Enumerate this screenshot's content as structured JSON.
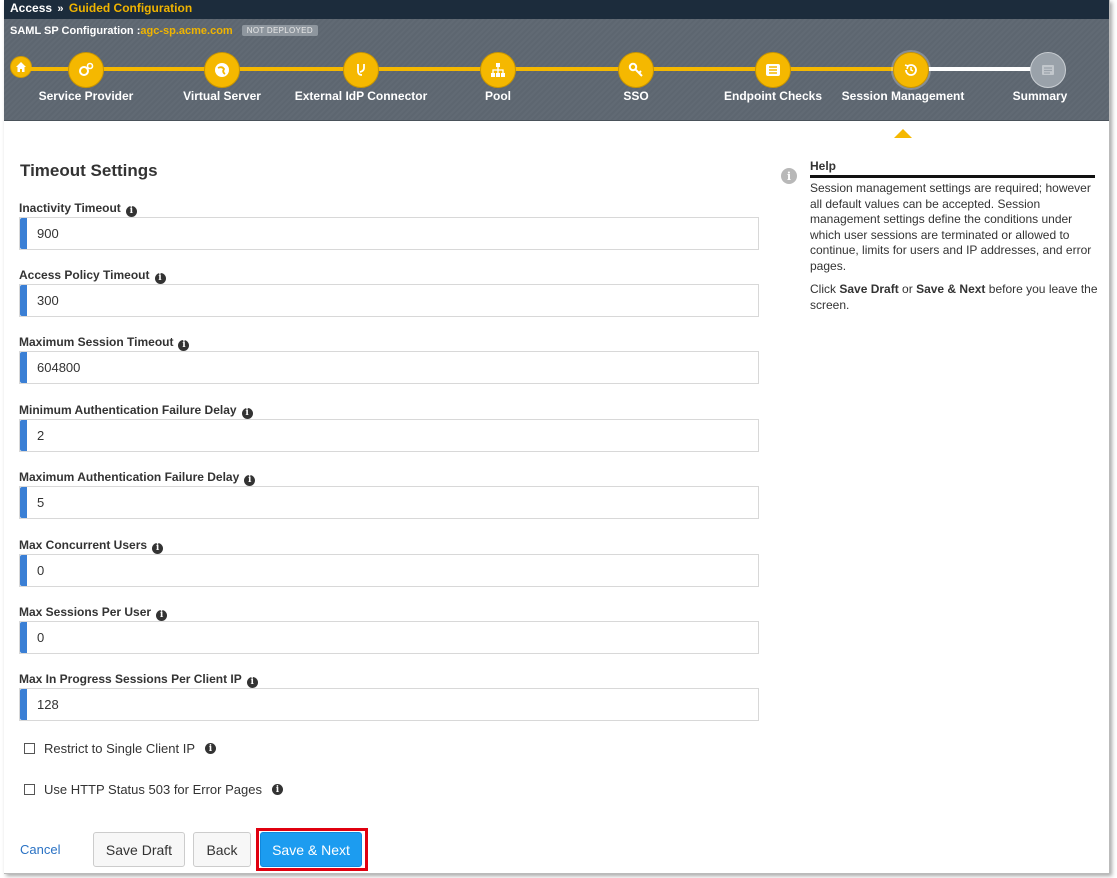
{
  "breadcrumb": {
    "root": "Access",
    "separator": "»",
    "current": "Guided Configuration"
  },
  "header": {
    "label": "SAML SP Configuration :",
    "host": "agc-sp.acme.com",
    "status": "NOT DEPLOYED"
  },
  "steps": [
    {
      "label": "Service Provider",
      "icon": "gears-icon",
      "state": "done"
    },
    {
      "label": "Virtual Server",
      "icon": "globe-icon",
      "state": "done"
    },
    {
      "label": "External IdP Connector",
      "icon": "branch-icon",
      "state": "done"
    },
    {
      "label": "Pool",
      "icon": "sitemap-icon",
      "state": "done"
    },
    {
      "label": "SSO",
      "icon": "key-icon",
      "state": "done"
    },
    {
      "label": "Endpoint Checks",
      "icon": "list-icon",
      "state": "done"
    },
    {
      "label": "Session Management",
      "icon": "history-icon",
      "state": "current"
    },
    {
      "label": "Summary",
      "icon": "document-icon",
      "state": "todo"
    }
  ],
  "section_title": "Timeout Settings",
  "fields": [
    {
      "label": "Inactivity Timeout",
      "value": "900"
    },
    {
      "label": "Access Policy Timeout",
      "value": "300"
    },
    {
      "label": "Maximum Session Timeout",
      "value": "604800"
    },
    {
      "label": "Minimum Authentication Failure Delay",
      "value": "2"
    },
    {
      "label": "Maximum Authentication Failure Delay",
      "value": "5"
    },
    {
      "label": "Max Concurrent Users",
      "value": "0"
    },
    {
      "label": "Max Sessions Per User",
      "value": "0"
    },
    {
      "label": "Max In Progress Sessions Per Client IP",
      "value": "128"
    }
  ],
  "checkboxes": [
    {
      "label": "Restrict to Single Client IP",
      "checked": false
    },
    {
      "label": "Use HTTP Status 503 for Error Pages",
      "checked": false
    }
  ],
  "actions": {
    "cancel": "Cancel",
    "save_draft": "Save Draft",
    "back": "Back",
    "save_next": "Save & Next"
  },
  "help": {
    "title": "Help",
    "paragraph1": "Session management settings are required; however all default values can be accepted. Session management settings define the conditions under which user sessions are terminated or allowed to continue, limits for users and IP addresses, and error pages.",
    "p2_pre": "Click ",
    "p2_b1": "Save Draft",
    "p2_mid": " or ",
    "p2_b2": "Save & Next",
    "p2_post": " before you leave the screen."
  },
  "colors": {
    "accent": "#f5b800",
    "primary_button": "#1c9cf0",
    "required_bar": "#3a7fd5",
    "highlight": "#e0000f"
  }
}
